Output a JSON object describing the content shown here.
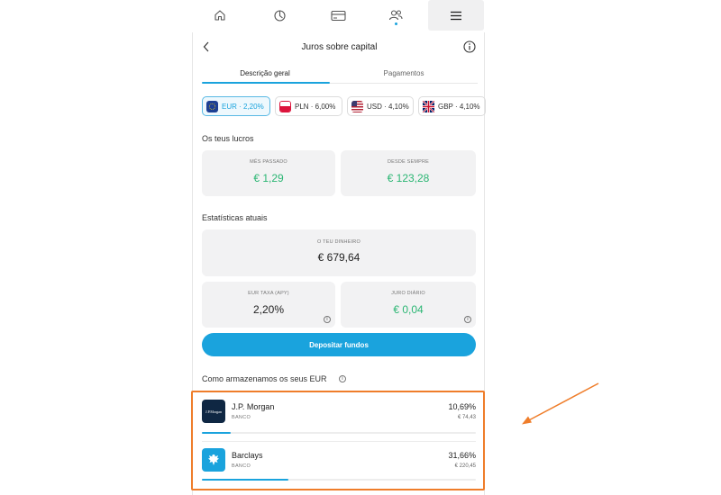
{
  "nav": {
    "items": [
      {
        "name": "home-icon"
      },
      {
        "name": "chart-icon"
      },
      {
        "name": "card-icon"
      },
      {
        "name": "people-icon"
      },
      {
        "name": "menu-icon"
      }
    ]
  },
  "header": {
    "title": "Juros sobre capital"
  },
  "tabs": [
    {
      "label": "Descrição geral",
      "active": true
    },
    {
      "label": "Pagamentos",
      "active": false
    }
  ],
  "currencies": [
    {
      "label": "EUR · 2,20%",
      "active": true,
      "flag_color": "#1c3f94"
    },
    {
      "label": "PLN · 6,00%",
      "active": false,
      "flag_color": "#dc143c"
    },
    {
      "label": "USD · 4,10%",
      "active": false,
      "flag_color": "#3c3b6e"
    },
    {
      "label": "GBP · 4,10%",
      "active": false,
      "flag_color": "#012169"
    }
  ],
  "profits": {
    "title": "Os teus lucros",
    "last_month_label": "MÊS PASSADO",
    "last_month_value": "€ 1,29",
    "all_time_label": "DESDE SEMPRE",
    "all_time_value": "€ 123,28"
  },
  "stats": {
    "title": "Estatísticas atuais",
    "money_label": "O TEU DINHEIRO",
    "money_value": "€ 679,64",
    "rate_label": "EUR TAXA (APY)",
    "rate_value": "2,20%",
    "daily_label": "JURO DIÁRIO",
    "daily_value": "€ 0,04"
  },
  "deposit_button": "Depositar fundos",
  "storage": {
    "title": "Como armazenamos os seus EUR",
    "banks": [
      {
        "name": "J.P. Morgan",
        "logo_text": "J.P.Morgan",
        "type": "BANCO",
        "percent": "10,69%",
        "amount": "€ 74,43",
        "fraction": 0.1069,
        "logo_color": "#0f2743"
      },
      {
        "name": "Barclays",
        "type": "BANCO",
        "percent": "31,66%",
        "amount": "€ 220,45",
        "fraction": 0.3166,
        "logo_color": "#1aa3dd"
      }
    ]
  },
  "colors": {
    "accent": "#1aa3dd",
    "positive": "#2bb673",
    "annotation": "#ef7d2a"
  }
}
